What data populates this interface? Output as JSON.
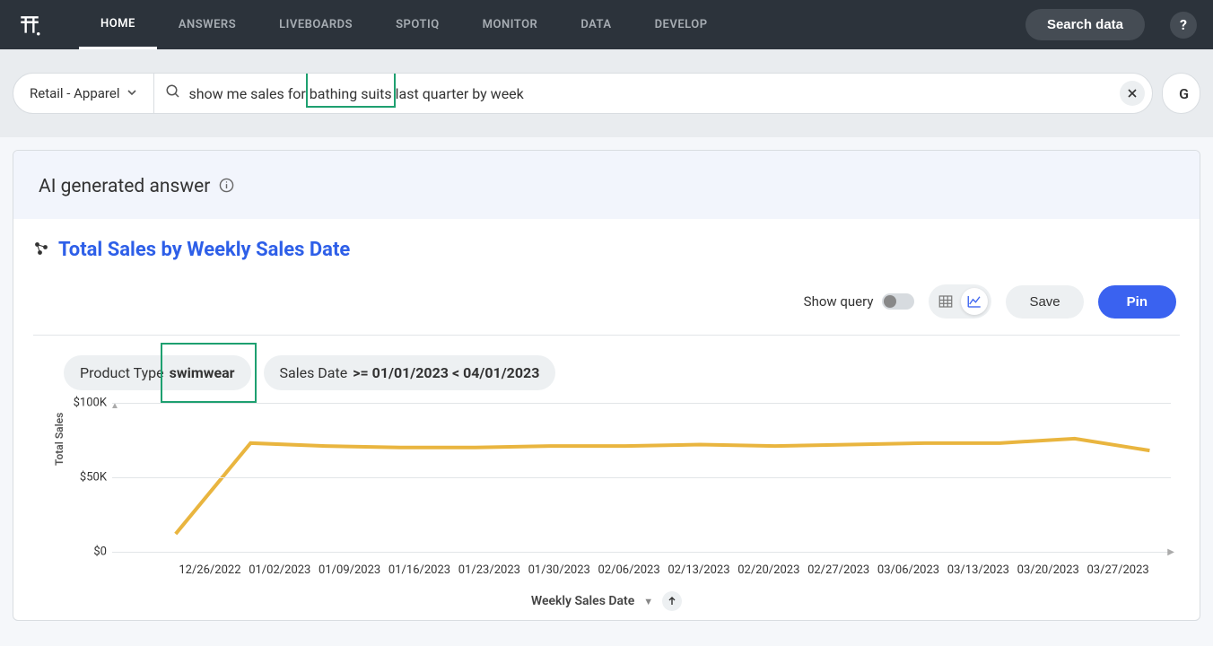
{
  "nav": {
    "items": [
      "HOME",
      "ANSWERS",
      "LIVEBOARDS",
      "SPOTIQ",
      "MONITOR",
      "DATA",
      "DEVELOP"
    ],
    "active_index": 0,
    "search_data_label": "Search data",
    "help_label": "?"
  },
  "search": {
    "source": "Retail - Apparel",
    "query_prefix": "show me sales for ",
    "query_highlight": "bathing suits",
    "query_suffix": " last quarter by week",
    "go_label": "G"
  },
  "answer": {
    "header": "AI generated answer",
    "chart_title": "Total Sales by Weekly Sales Date",
    "toolbar": {
      "show_query_label": "Show query",
      "save_label": "Save",
      "pin_label": "Pin"
    },
    "filters": [
      {
        "label": "Product Type",
        "value": "swimwear"
      },
      {
        "label": "Sales Date",
        "value": ">= 01/01/2023 < 04/01/2023"
      }
    ],
    "xlabel": "Weekly Sales Date"
  },
  "chart_data": {
    "type": "line",
    "title": "Total Sales by Weekly Sales Date",
    "xlabel": "Weekly Sales Date",
    "ylabel": "Total Sales",
    "y_ticks": [
      "$0",
      "$50K",
      "$100K"
    ],
    "ylim": [
      0,
      100000
    ],
    "categories": [
      "12/26/2022",
      "01/02/2023",
      "01/09/2023",
      "01/16/2023",
      "01/23/2023",
      "01/30/2023",
      "02/06/2023",
      "02/13/2023",
      "02/20/2023",
      "02/27/2023",
      "03/06/2023",
      "03/13/2023",
      "03/20/2023",
      "03/27/2023"
    ],
    "series": [
      {
        "name": "Total Sales",
        "color": "#e9b53f",
        "values": [
          12000,
          73000,
          71000,
          70000,
          70000,
          71000,
          71000,
          72000,
          71000,
          72000,
          73000,
          73000,
          76000,
          68000
        ]
      }
    ]
  }
}
